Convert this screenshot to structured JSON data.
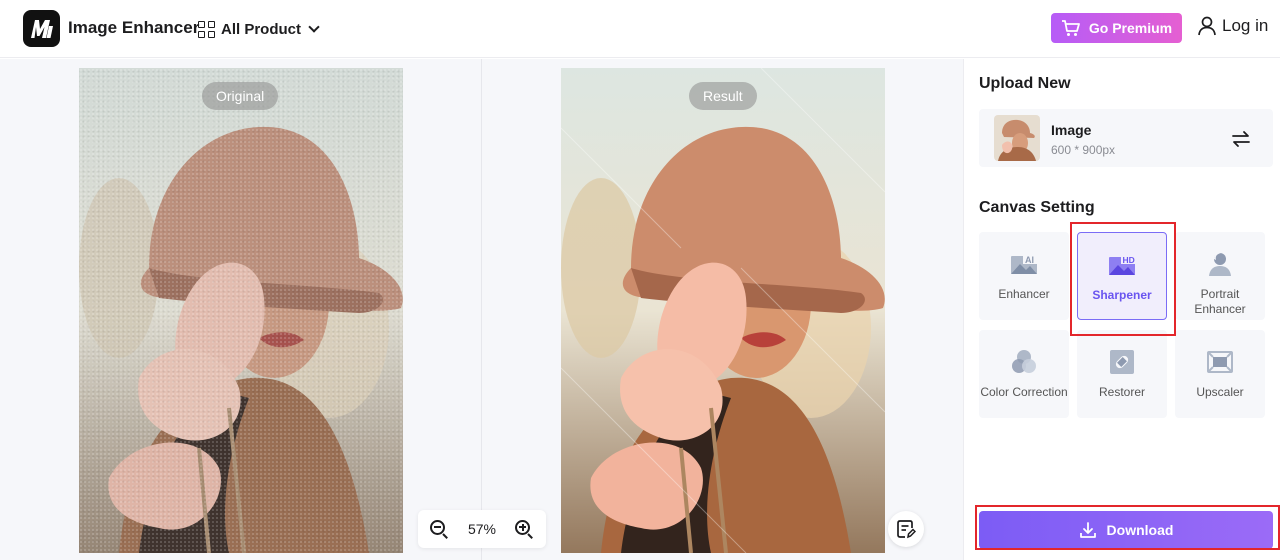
{
  "header": {
    "logo_text": "M",
    "app_title": "Image Enhancer",
    "all_product_label": "All Product",
    "premium_label": "Go Premium",
    "login_label": "Log in"
  },
  "canvas": {
    "original_tag": "Original",
    "result_tag": "Result",
    "zoom_percent": "57%"
  },
  "sidebar": {
    "upload_title": "Upload New",
    "image_name": "Image",
    "image_size": "600 * 900px",
    "canvas_title": "Canvas Setting",
    "tools": [
      {
        "label": "Enhancer",
        "icon": "ai-image-icon"
      },
      {
        "label": "Sharpener",
        "icon": "hd-image-icon"
      },
      {
        "label": "Portrait Enhancer",
        "icon": "portrait-icon"
      },
      {
        "label": "Color Correction",
        "icon": "color-circles-icon"
      },
      {
        "label": "Restorer",
        "icon": "bandage-image-icon"
      },
      {
        "label": "Upscaler",
        "icon": "expand-frame-icon"
      }
    ],
    "selected_tool": "Sharpener",
    "download_label": "Download"
  },
  "colors": {
    "accent": "#7c5cf5",
    "premium_start": "#b65cf7",
    "premium_end": "#e55fd2",
    "highlight_box": "#e3262b"
  }
}
